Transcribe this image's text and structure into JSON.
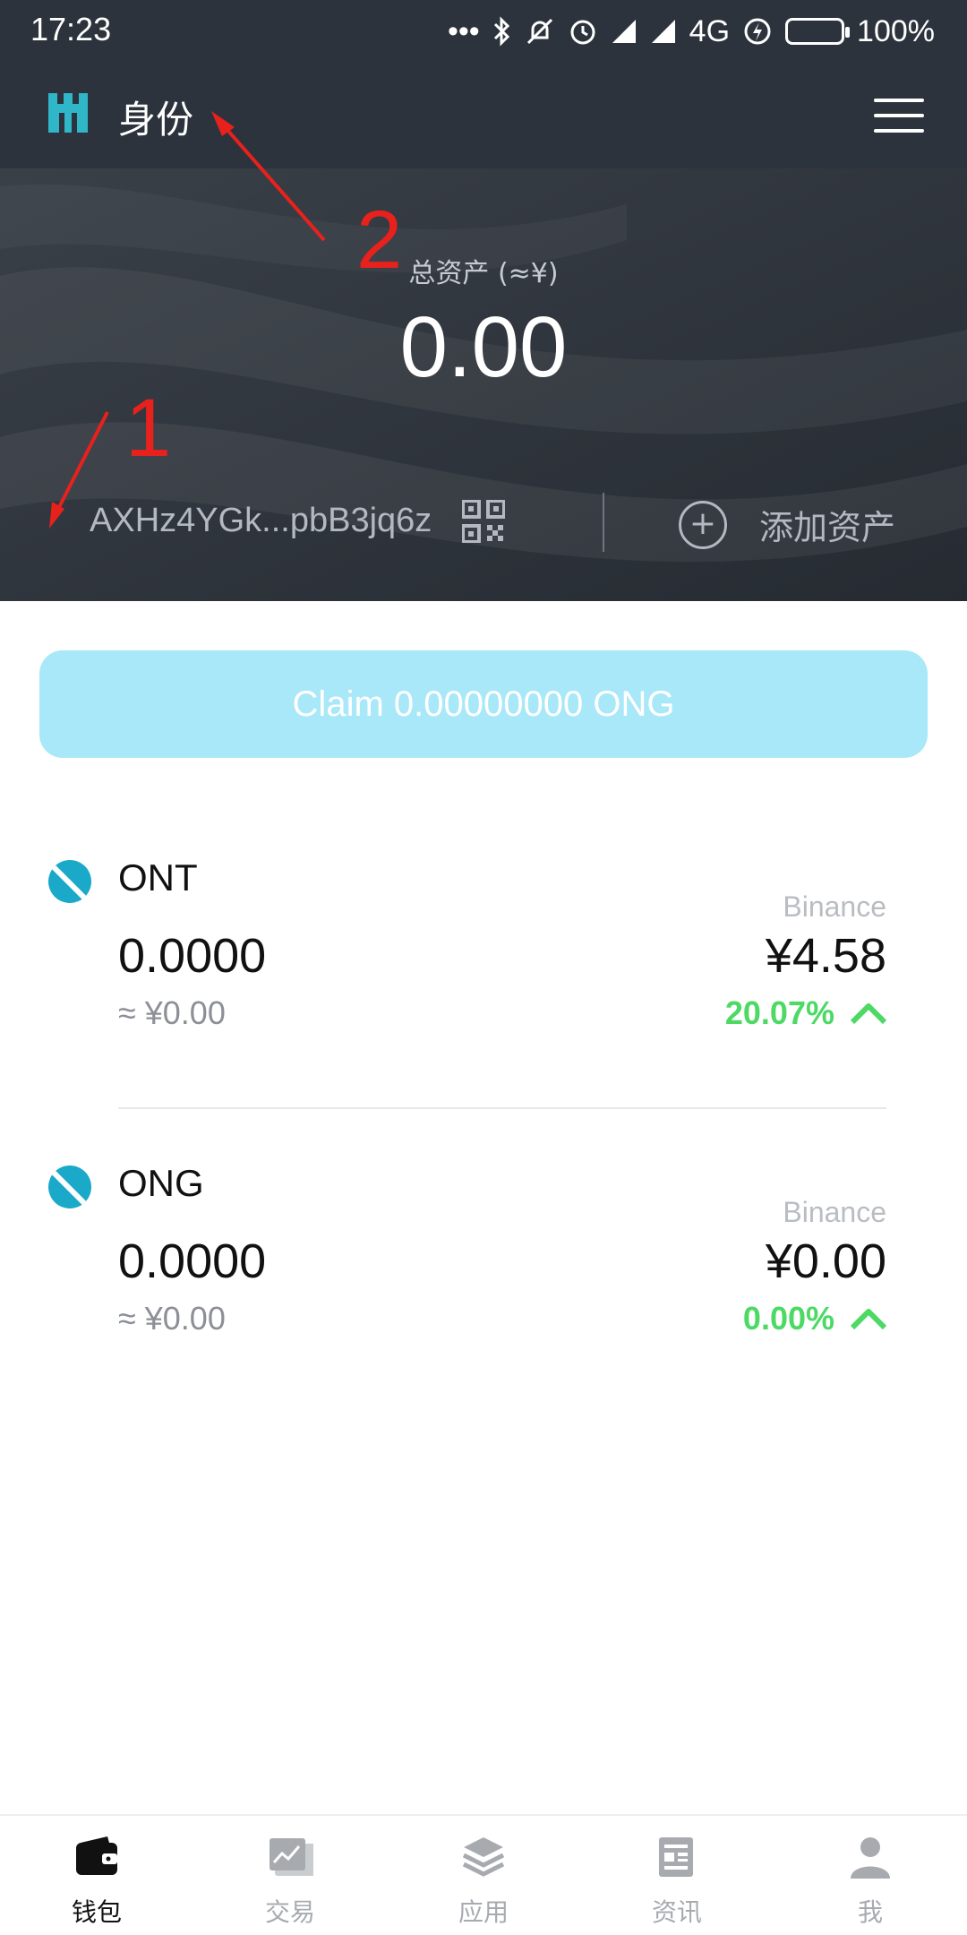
{
  "status_bar": {
    "time": "17:23",
    "network": "4G",
    "battery": "100%"
  },
  "header": {
    "title": "身份"
  },
  "hero": {
    "total_label": "总资产 (≈¥)",
    "total_value": "0.00",
    "address": "AXHz4YGk...pbB3jq6z",
    "add_asset_label": "添加资产"
  },
  "annotations": {
    "one": "1",
    "two": "2"
  },
  "claim": {
    "label": "Claim 0.00000000 ONG"
  },
  "tokens": [
    {
      "name": "ONT",
      "exchange": "Binance",
      "amount": "0.0000",
      "price": "¥4.58",
      "fiat": "≈ ¥0.00",
      "change": "20.07%"
    },
    {
      "name": "ONG",
      "exchange": "Binance",
      "amount": "0.0000",
      "price": "¥0.00",
      "fiat": "≈ ¥0.00",
      "change": "0.00%"
    }
  ],
  "nav": {
    "items": [
      {
        "label": "钱包",
        "icon": "wallet-icon"
      },
      {
        "label": "交易",
        "icon": "chart-icon"
      },
      {
        "label": "应用",
        "icon": "layers-icon"
      },
      {
        "label": "资讯",
        "icon": "news-icon"
      },
      {
        "label": "我",
        "icon": "user-icon"
      }
    ],
    "active_index": 0
  },
  "colors": {
    "header_bg": "#2c333c",
    "brand_teal": "#1aa9c9",
    "claim_bg": "#a9e8f8",
    "positive": "#4cd964",
    "annotation": "#e8211d"
  }
}
